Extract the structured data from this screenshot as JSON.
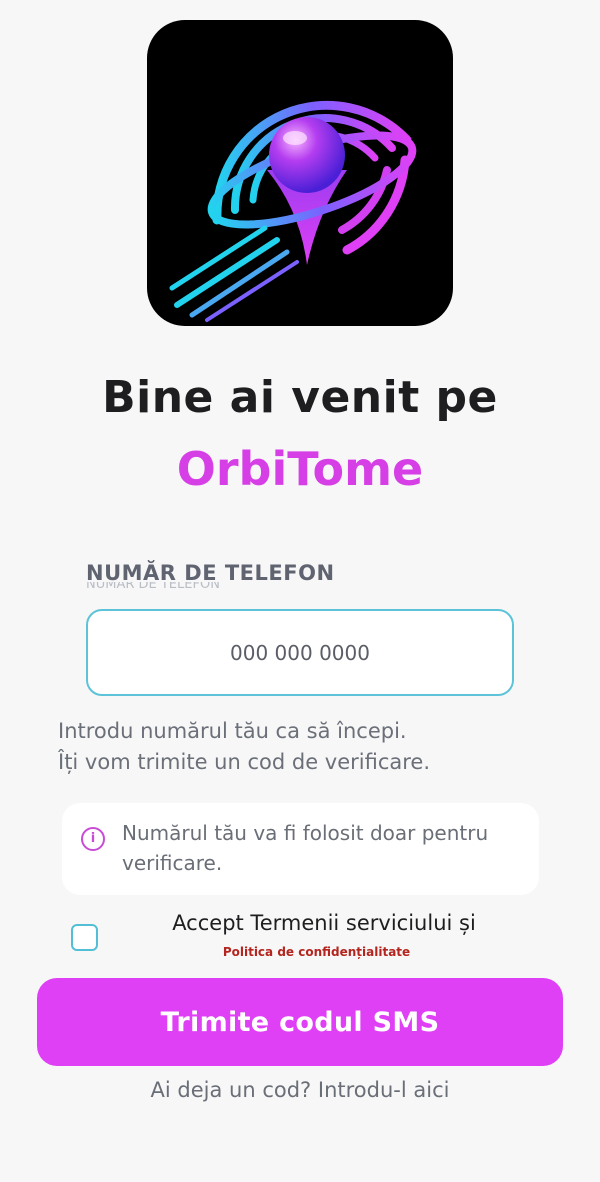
{
  "logo": {
    "icon": "orbit-location-pin-logo",
    "colors": {
      "cyan": "#22d3ee",
      "magenta": "#e040f5",
      "purple": "#7c3aed"
    }
  },
  "welcome": {
    "line1": "Bine ai venit pe",
    "brand": "OrbiTome"
  },
  "phone": {
    "label": "NUMĂR DE TELEFON",
    "placeholder": "000 000 0000",
    "value": ""
  },
  "helper": {
    "line1": "Introdu numărul tău ca să începi.",
    "line2": "Îți vom trimite un cod de verificare."
  },
  "notice": {
    "icon": "info-icon",
    "text": "Numărul tău va fi folosit doar pentru verificare."
  },
  "terms": {
    "checked": false,
    "text": "Accept Termenii serviciului și",
    "privacy_link": "Politica de confidențialitate"
  },
  "actions": {
    "send_label": "Trimite codul SMS",
    "have_code": "Ai deja un cod? Introdu-l aici"
  },
  "colors": {
    "accent": "#e040f5",
    "brand": "#d63ee6",
    "input_border": "#5cc3d8",
    "link": "#b3251e"
  }
}
